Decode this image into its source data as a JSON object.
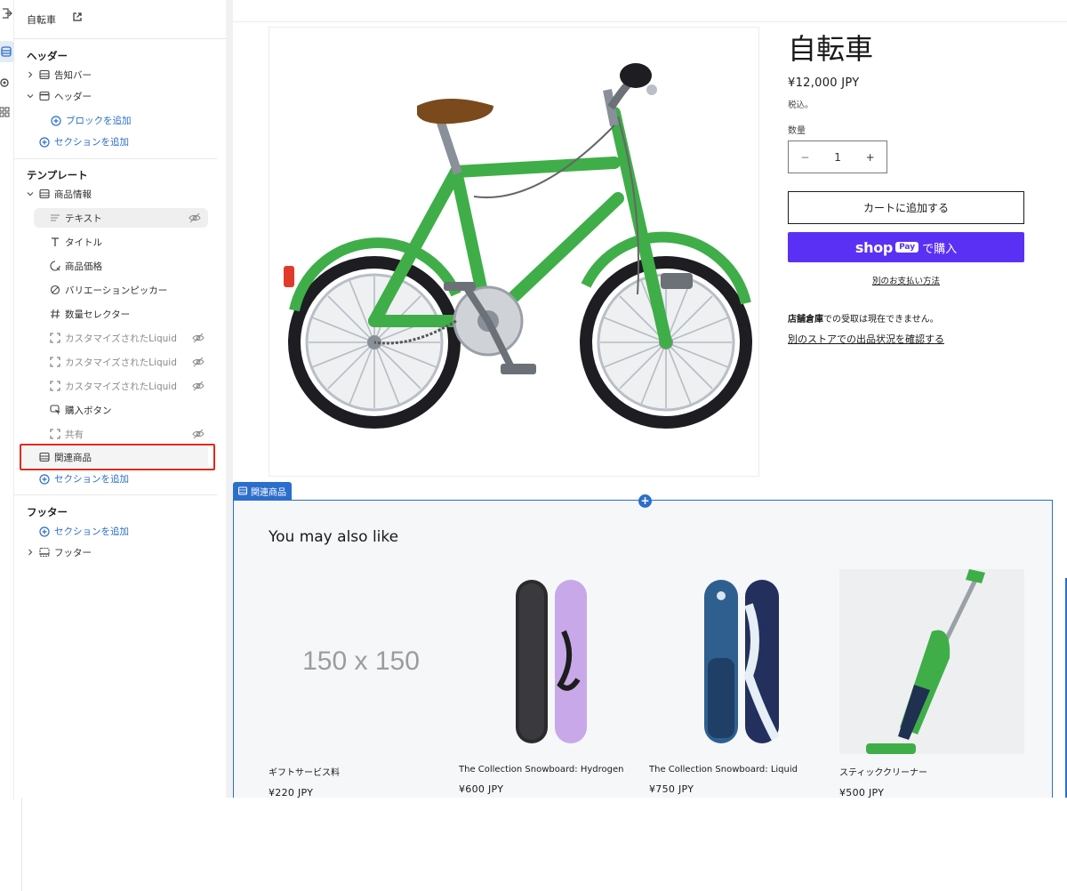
{
  "sidebar": {
    "page_title": "自転車",
    "header_group": {
      "title": "ヘッダー",
      "items": [
        {
          "label": "告知バー"
        },
        {
          "label": "ヘッダー"
        }
      ],
      "add_block": "ブロックを追加",
      "add_section": "セクションを追加"
    },
    "template_group": {
      "title": "テンプレート",
      "product_info": "商品情報",
      "blocks": [
        {
          "label": "テキスト",
          "hidden": true
        },
        {
          "label": "タイトル",
          "hidden": false
        },
        {
          "label": "商品価格",
          "hidden": false
        },
        {
          "label": "バリエーションピッカー",
          "hidden": false
        },
        {
          "label": "数量セレクター",
          "hidden": false
        },
        {
          "label": "カスタマイズされたLiquid",
          "hidden": true
        },
        {
          "label": "カスタマイズされたLiquid",
          "hidden": true
        },
        {
          "label": "カスタマイズされたLiquid",
          "hidden": true
        },
        {
          "label": "購入ボタン",
          "hidden": false
        },
        {
          "label": "共有",
          "hidden": true
        }
      ],
      "related": "関連商品",
      "add_section": "セクションを追加"
    },
    "footer_group": {
      "title": "フッター",
      "add_section": "セクションを追加",
      "footer": "フッター"
    }
  },
  "product": {
    "title": "自転車",
    "price": "¥12,000 JPY",
    "tax_note": "税込。",
    "quantity_label": "数量",
    "quantity": "1",
    "add_to_cart": "カートに追加する",
    "shop_word": "shop",
    "pay_badge": "Pay",
    "buy_suffix": "で購入",
    "alt_payment": "別のお支払い方法",
    "pickup_store": "店舗倉庫",
    "pickup_text": "での受取は現在できません。",
    "other_store": "別のストアでの出品状況を確認する"
  },
  "related": {
    "tag": "関連商品",
    "heading": "You may also like",
    "cards": [
      {
        "name": "ギフトサービス料",
        "price": "¥220 JPY",
        "placeholder": "150 x 150"
      },
      {
        "name": "The Collection Snowboard: Hydrogen",
        "price": "¥600 JPY"
      },
      {
        "name": "The Collection Snowboard: Liquid",
        "price": "¥750 JPY"
      },
      {
        "name": "スティッククリーナー",
        "price": "¥500 JPY"
      }
    ]
  },
  "colors": {
    "accent": "#2c6ecb",
    "shop_pay": "#5a31f4",
    "highlight": "#e0291b",
    "bike_green": "#3fae49"
  }
}
